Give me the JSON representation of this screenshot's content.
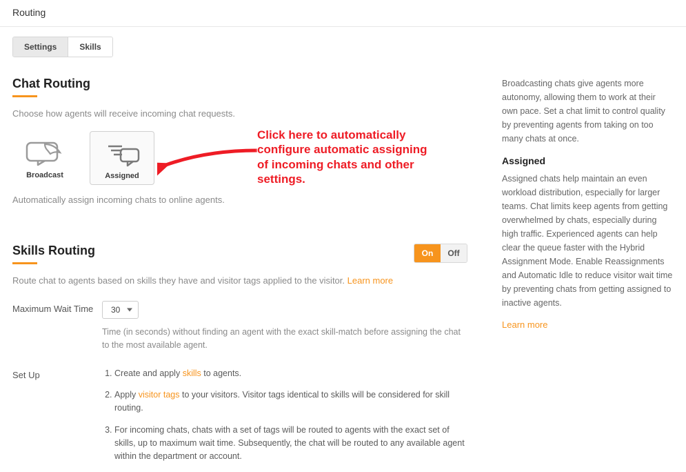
{
  "page_title": "Routing",
  "tabs": {
    "settings": "Settings",
    "skills": "Skills"
  },
  "chat_routing": {
    "title": "Chat Routing",
    "subtitle": "Choose how agents will receive incoming chat requests.",
    "broadcast_label": "Broadcast",
    "assigned_label": "Assigned",
    "desc": "Automatically assign incoming chats to online agents."
  },
  "annotation": {
    "text": "Click here to automatically configure automatic assigning of incoming chats and other settings."
  },
  "skills_routing": {
    "title": "Skills Routing",
    "on": "On",
    "off": "Off",
    "desc_pre": "Route chat to agents based on skills they have and visitor tags applied to the visitor. ",
    "learn_more": "Learn more",
    "wait_label": "Maximum Wait Time",
    "wait_value": "30",
    "wait_help": "Time (in seconds) without finding an agent with the exact skill-match before assigning the chat to the most available agent.",
    "setup_label": "Set Up",
    "steps": {
      "s1_pre": "Create and apply ",
      "s1_link": "skills",
      "s1_post": " to agents.",
      "s2_pre": "Apply ",
      "s2_link": "visitor tags",
      "s2_post": " to your visitors. Visitor tags identical to skills will be considered for skill routing.",
      "s3": "For incoming chats, chats with a set of tags will be routed to agents with the exact set of skills, up to maximum wait time. Subsequently, the chat will be routed to any available agent within the department or account."
    }
  },
  "side": {
    "broadcast_text": "Broadcasting chats give agents more autonomy, allowing them to work at their own pace. Set a chat limit to control quality by preventing agents from taking on too many chats at once.",
    "assigned_title": "Assigned",
    "assigned_text": "Assigned chats help maintain an even workload distribution, especially for larger teams. Chat limits keep agents from getting overwhelmed by chats, especially during high traffic. Experienced agents can help clear the queue faster with the Hybrid Assignment Mode. Enable Reassignments and Automatic Idle to reduce visitor wait time by preventing chats from getting assigned to inactive agents.",
    "learn_more": "Learn more"
  }
}
